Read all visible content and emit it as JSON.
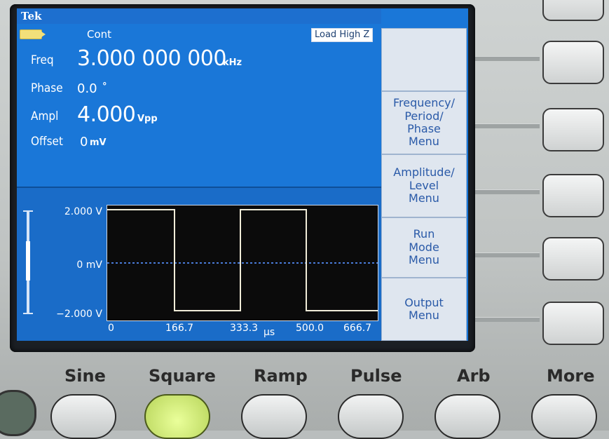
{
  "header": {
    "brand": "Tek",
    "mode": "Cont",
    "load": "Load High Z"
  },
  "params": {
    "freq": {
      "label": "Freq",
      "value": "3.000 000 000",
      "unit": "kHz"
    },
    "phase": {
      "label": "Phase",
      "value": "0.0",
      "unit": "°"
    },
    "ampl": {
      "label": "Ampl",
      "value": "4.000",
      "unit": "Vpp"
    },
    "offset": {
      "label": "Offset",
      "value": "0",
      "unit": "mV"
    }
  },
  "softkeys": [
    {
      "label": ""
    },
    {
      "label": "Frequency/ Period/ Phase Menu"
    },
    {
      "label": "Amplitude/ Level Menu"
    },
    {
      "label": "Run Mode Menu"
    },
    {
      "label": "Output Menu"
    }
  ],
  "plot": {
    "y_top": "2.000 V",
    "y_mid": "0 mV",
    "y_bot": "−2.000 V",
    "x_ticks": [
      "0",
      "166.7",
      "333.3",
      "500.0",
      "666.7"
    ],
    "x_unit": "µs"
  },
  "function_buttons": [
    {
      "label": "Sine",
      "lit": false
    },
    {
      "label": "Square",
      "lit": true
    },
    {
      "label": "Ramp",
      "lit": false
    },
    {
      "label": "Pulse",
      "lit": false
    },
    {
      "label": "Arb",
      "lit": false
    },
    {
      "label": "More",
      "lit": false
    }
  ],
  "colors": {
    "screen": "#1a77d8",
    "softkey": "#dfe6ef",
    "trace": "#f0ecd8",
    "plot_bg": "#0b0b0b"
  }
}
